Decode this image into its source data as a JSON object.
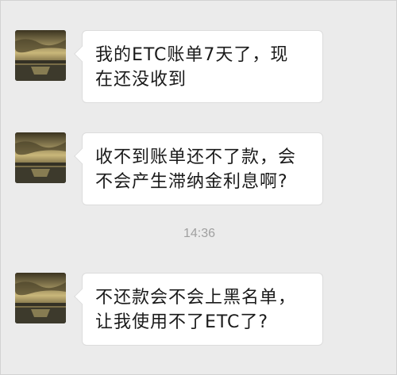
{
  "messages": [
    {
      "text": "我的ETC账单7天了，现\n在还没收到"
    },
    {
      "text": "收不到账单还不了款，会\n不会产生滞纳金利息啊?"
    },
    {
      "text": "不还款会不会上黑名单，\n让我使用不了ETC了?"
    }
  ],
  "timestamp": "14:36",
  "avatar": {
    "icon": "sunset-sea-photo"
  }
}
